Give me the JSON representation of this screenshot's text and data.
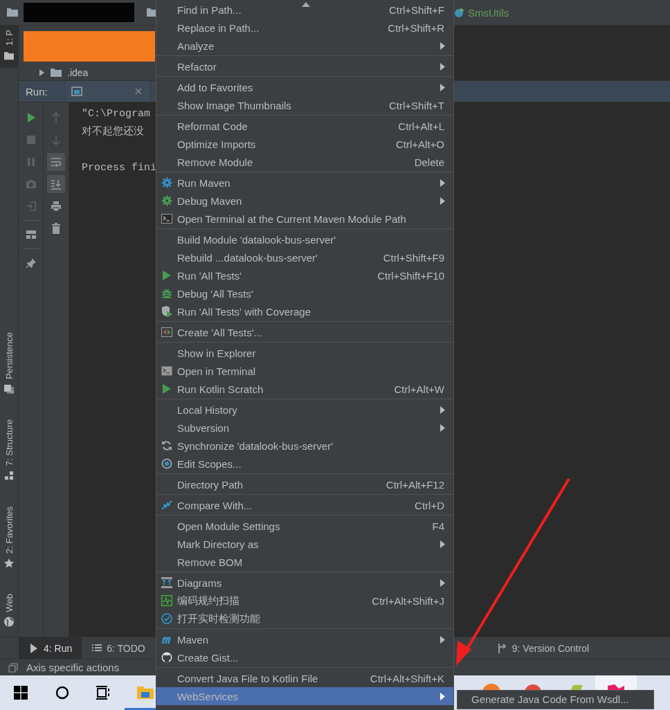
{
  "nav_bar": {
    "editor_tab": "SmsUtils"
  },
  "left_tool_strip": {
    "tabs": [
      {
        "label": "1: P",
        "selected": true
      },
      {
        "label": "Persistence",
        "selected": false
      },
      {
        "label": "7: Structure",
        "selected": false
      },
      {
        "label": "2: Favorites",
        "selected": false
      },
      {
        "label": "Web",
        "selected": false
      }
    ]
  },
  "project_tree": {
    "items": [
      {
        "label": ".idea",
        "expanded": false
      }
    ]
  },
  "run_panel": {
    "title": "Run:",
    "secondary_toolbar": [
      {
        "on": false
      },
      {
        "on": false
      },
      {
        "on": true
      },
      {
        "on": true
      },
      {
        "on": false
      },
      {
        "on": false
      }
    ],
    "console_output": "\"C:\\Program\n对不起您还没\n\nProcess fini"
  },
  "bottom_tool_bar": {
    "tabs": [
      {
        "label": "4: Run",
        "selected": true
      },
      {
        "label": "6: TODO",
        "selected": false
      },
      {
        "label": "9: Version Control",
        "selected": false
      }
    ]
  },
  "status_bar": {
    "text": "Axis specific actions"
  },
  "context_menu": {
    "groups": [
      {
        "items": [
          {
            "label": "Find in Path...",
            "shortcut": "Ctrl+Shift+F",
            "has_submenu": false,
            "selected": false
          },
          {
            "label": "Replace in Path...",
            "shortcut": "Ctrl+Shift+R",
            "has_submenu": false,
            "selected": false
          },
          {
            "label": "Analyze",
            "has_submenu": true,
            "selected": false
          }
        ]
      },
      {
        "items": [
          {
            "label": "Refactor",
            "has_submenu": true,
            "selected": false
          }
        ]
      },
      {
        "items": [
          {
            "label": "Add to Favorites",
            "has_submenu": true,
            "selected": false
          },
          {
            "label": "Show Image Thumbnails",
            "shortcut": "Ctrl+Shift+T",
            "has_submenu": false,
            "selected": false
          }
        ]
      },
      {
        "items": [
          {
            "label": "Reformat Code",
            "shortcut": "Ctrl+Alt+L",
            "has_submenu": false,
            "selected": false
          },
          {
            "label": "Optimize Imports",
            "shortcut": "Ctrl+Alt+O",
            "has_submenu": false,
            "selected": false
          },
          {
            "label": "Remove Module",
            "shortcut": "Delete",
            "has_submenu": false,
            "selected": false
          }
        ]
      },
      {
        "items": [
          {
            "label": "Run Maven",
            "has_submenu": true,
            "selected": false
          },
          {
            "label": "Debug Maven",
            "has_submenu": true,
            "selected": false
          },
          {
            "label": "Open Terminal at the Current Maven Module Path",
            "has_submenu": false,
            "selected": false
          }
        ]
      },
      {
        "items": [
          {
            "label": "Build Module 'datalook-bus-server'",
            "has_submenu": false,
            "selected": false
          },
          {
            "label": "Rebuild ...datalook-bus-server'",
            "shortcut": "Ctrl+Shift+F9",
            "has_submenu": false,
            "selected": false
          },
          {
            "label": "Run 'All Tests'",
            "shortcut": "Ctrl+Shift+F10",
            "has_submenu": false,
            "selected": false
          },
          {
            "label": "Debug 'All Tests'",
            "has_submenu": false,
            "selected": false
          },
          {
            "label": "Run 'All Tests' with Coverage",
            "has_submenu": false,
            "selected": false
          }
        ]
      },
      {
        "items": [
          {
            "label": "Create 'All Tests'...",
            "has_submenu": false,
            "selected": false
          }
        ]
      },
      {
        "items": [
          {
            "label": "Show in Explorer",
            "has_submenu": false,
            "selected": false
          },
          {
            "label": "Open in Terminal",
            "has_submenu": false,
            "selected": false
          },
          {
            "label": "Run Kotlin Scratch",
            "shortcut": "Ctrl+Alt+W",
            "has_submenu": false,
            "selected": false
          }
        ]
      },
      {
        "items": [
          {
            "label": "Local History",
            "has_submenu": true,
            "selected": false
          },
          {
            "label": "Subversion",
            "has_submenu": true,
            "selected": false
          },
          {
            "label": "Synchronize 'datalook-bus-server'",
            "has_submenu": false,
            "selected": false
          },
          {
            "label": "Edit Scopes...",
            "has_submenu": false,
            "selected": false
          }
        ]
      },
      {
        "items": [
          {
            "label": "Directory Path",
            "shortcut": "Ctrl+Alt+F12",
            "has_submenu": false,
            "selected": false
          }
        ]
      },
      {
        "items": [
          {
            "label": "Compare With...",
            "shortcut": "Ctrl+D",
            "has_submenu": false,
            "selected": false
          }
        ]
      },
      {
        "items": [
          {
            "label": "Open Module Settings",
            "shortcut": "F4",
            "has_submenu": false,
            "selected": false
          },
          {
            "label": "Mark Directory as",
            "has_submenu": true,
            "selected": false
          },
          {
            "label": "Remove BOM",
            "has_submenu": false,
            "selected": false
          }
        ]
      },
      {
        "items": [
          {
            "label": "Diagrams",
            "has_submenu": true,
            "selected": false
          },
          {
            "label": "编码规约扫描",
            "shortcut": "Ctrl+Alt+Shift+J",
            "has_submenu": false,
            "selected": false
          },
          {
            "label": "打开实时检测功能",
            "has_submenu": false,
            "selected": false
          }
        ]
      },
      {
        "items": [
          {
            "label": "Maven",
            "has_submenu": true,
            "selected": false
          },
          {
            "label": "Create Gist...",
            "has_submenu": false,
            "selected": false
          }
        ]
      },
      {
        "items": [
          {
            "label": "Convert Java File to Kotlin File",
            "shortcut": "Ctrl+Alt+Shift+K",
            "has_submenu": false,
            "selected": false
          },
          {
            "label": "WebServices",
            "has_submenu": true,
            "selected": true
          }
        ]
      }
    ]
  },
  "submenu": {
    "items": [
      {
        "label": "Generate Java Code From Wsdl...",
        "selected": false
      }
    ]
  }
}
